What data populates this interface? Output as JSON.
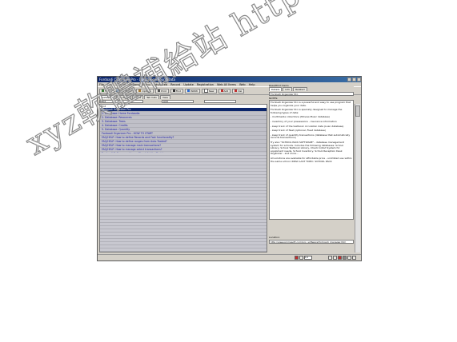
{
  "window": {
    "title": "Fordoadi Organizer Pro - Database - SoundData"
  },
  "menu": [
    "File",
    "Edit",
    "Search",
    "Options",
    "Menu",
    "Advanced",
    "Record",
    "Update",
    "Registration",
    "Web All Items",
    "Web",
    "Help"
  ],
  "toolbar": [
    "Find",
    "Find Match",
    "Options",
    "Print",
    "Find",
    "WWW",
    "New",
    "Add",
    "Del"
  ],
  "tabs": [
    "Database",
    "Sections",
    "Tasks",
    "Tab Cats",
    "View"
  ],
  "search": {
    "value": "Find",
    "value2": "Add"
  },
  "left": {
    "header": "Find",
    "items": [
      "Fordoadi Organizer Pro",
      "1. Database: Home Fordoadia",
      "2. Database: Resources",
      "3. Database: Trees",
      "4. Database: Credits",
      "5. Database: Quantity",
      "Fordoadi Organizer Pro - HOW TO START",
      "FAQ/HELP: How to define Records and Fast functionality?",
      "FAQ/HELP: How to define ranges from Auto-Traded?",
      "FAQ/HELP: How to manage main transactions?",
      "FAQ/HELP: How to manage select transactions?",
      "Fordoadi Software, add-ons: Check list for Module",
      "Fordoadi Software, add-ons: All Division/Archive",
      "Fordoadi Software, add-ons: Search Module (OPAC)",
      "SCHOOL PACK: school database management system"
    ]
  },
  "right": {
    "label": "Read/Print items",
    "tabs": [
      "Details",
      "Info",
      "Related"
    ],
    "title": "Fordoadi Organizer Pro",
    "note": "NOTES:",
    "paragraphs": [
      "Fordoadi Organizer Pro is a powerful and easy to use program that helps you organize your data.",
      "Fordoadi Organizer Pro is specially designed to manage the following types of data:",
      "- multimedia collections (Movies Music database)",
      "- inventory of your possessions - insurance information",
      "- keep track of the textbook circulation data (Loan database)",
      "- keep track of fleet (optional, Fleet database)",
      "- keep track of quantity transactions (database that automatically records transactions)",
      "Try also \"SCHOOL PACK SOFTWARE\" - database management system for schools. Includes the following databases: School Library, School Textbook Library, Check In/Out System for equipment needs, School Inventory, School Reception Desk Organizer - and more...",
      "All solutions are available for affordable price - unlimited use within the same school. READ LAST TOPIC: SCHOOL PACK"
    ],
    "url_label": "Location:",
    "url": "http://www.primasoft.com/pro_software/fordoadi_manager.htm"
  },
  "status": {
    "page": "1/1"
  },
  "watermark": "xyz軟體補給站 http://31.to"
}
